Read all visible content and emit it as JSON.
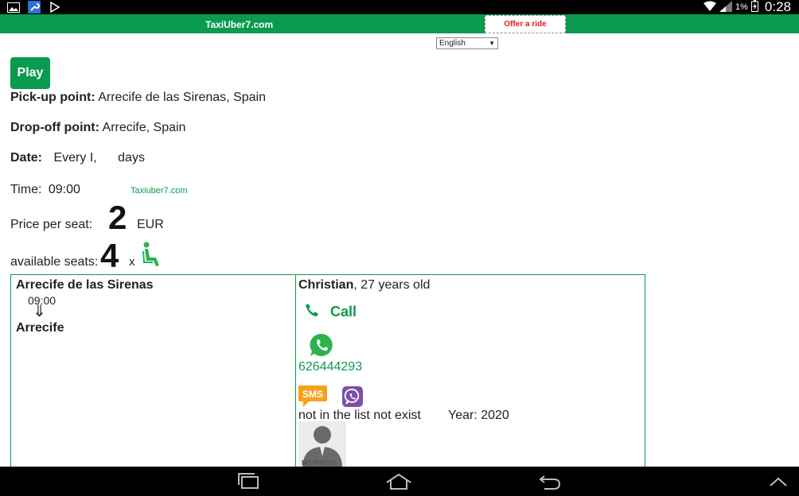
{
  "status_bar": {
    "time": "0:28",
    "battery": "1%",
    "icons": [
      "image-icon",
      "wrench-icon",
      "play-store-icon",
      "wifi-icon",
      "signal-icon",
      "battery-charging-icon"
    ]
  },
  "header": {
    "brand": "TaxiUber7.com",
    "offer_label": "Offer a ride",
    "brand_color": "#0a9b4e",
    "offer_color": "#e61b1b"
  },
  "language_select": {
    "selected": "English"
  },
  "play_button": {
    "label": "Play"
  },
  "trip": {
    "pickup_label": "Pick-up point:",
    "pickup_value": "Arrecife de las Sirenas, Spain",
    "dropoff_label": "Drop-off point:",
    "dropoff_value": "Arrecife, Spain",
    "date_label": "Date:",
    "date_value": "Every I,",
    "date_suffix": "days",
    "time_label": "Time:",
    "time_value": "09:00",
    "watermark": "Taxiuber7.com",
    "price_label": "Price per seat:",
    "price_value": "2",
    "currency": "EUR",
    "seats_label": "available seats:",
    "seats_value": "4",
    "seats_x": "x"
  },
  "route_panel": {
    "from": "Arrecife de las Sirenas",
    "time": "09:00",
    "arrow": "⇓",
    "to": "Arrecife"
  },
  "driver_panel": {
    "name": "Christian",
    "age_text": ", 27 years old",
    "call_label": "Call",
    "phone": "626444293",
    "sms_label": "SMS",
    "car_text": "not in the list not exist",
    "year_text": "Year: 2020",
    "photo_label": "NO PHOTO"
  }
}
